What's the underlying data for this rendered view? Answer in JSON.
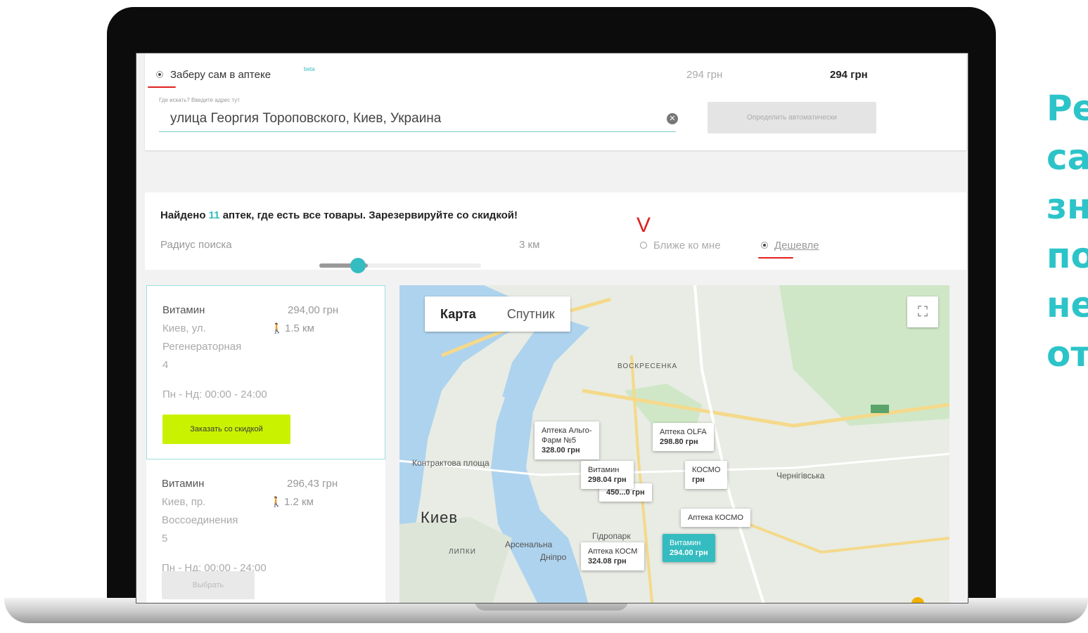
{
  "delivery": {
    "pickup_label": "Заберу сам в аптеке",
    "beta_badge": "beta",
    "price_left": "294 грн",
    "price_right": "294 грн"
  },
  "address": {
    "hint": "Где искать? Введите адрес тут",
    "value": "улица Георгия Тороповского, Киев, Украина",
    "auto_button": "Определить автоматически"
  },
  "filter": {
    "found_prefix": "Найдено",
    "found_count": "11",
    "found_suffix": "аптек, где есть все товары. Зарезервируйте со скидкой!",
    "radius_label": "Радиус поиска",
    "radius_value": "3 км",
    "radius_fraction": 0.3,
    "sort_nearer": "Ближе ко мне",
    "sort_cheaper": "Дешевле",
    "sort_selected": "Дешевле",
    "checkmark": "V"
  },
  "pharmacies": [
    {
      "name": "Витамин",
      "price": "294,00 грн",
      "distance": "1.5 км",
      "addr1": "Киев, ул.",
      "addr2": "Регенераторная",
      "addr3": "4",
      "hours": "Пн - Нд: 00:00 - 24:00",
      "button": "Заказать со скидкой"
    },
    {
      "name": "Витамин",
      "price": "296,43 грн",
      "distance": "1.2 км",
      "addr1": "Киев, пр.",
      "addr2": "Воссоединения",
      "addr3": "5",
      "hours": "Пн - Нд: 00:00 - 24:00",
      "button": "Выбрать"
    }
  ],
  "map": {
    "tab_map": "Карта",
    "tab_satellite": "Спутник",
    "city": "Киев",
    "labels": [
      "ВОСКРЕСЕНКА",
      "Контрактова площа",
      "Арсенальна",
      "Дніпро",
      "Чернігівська",
      "ЛИПКИ",
      "Гідропарк"
    ],
    "pins": [
      {
        "name": "Аптека Альго-",
        "name2": "Фарм №5",
        "price": "328.00 грн"
      },
      {
        "name": "Аптека OLFA",
        "price": "298.80 грн"
      },
      {
        "name": "Витамин",
        "price": "298.04 грн"
      },
      {
        "name": "КОСМО",
        "price": "грн"
      },
      {
        "name": "",
        "price": "450...0 грн"
      },
      {
        "name": "Аптека КОСМО",
        "price": ""
      },
      {
        "name": "Аптека КОСМ",
        "price": "324.08 грн"
      },
      {
        "name": "Витамин",
        "price": "294.00 грн"
      }
    ]
  },
  "promo_lines": [
    "Ре",
    "са",
    "зн",
    "по",
    "не",
    "от"
  ],
  "colors": {
    "accent": "#35bcc0",
    "order_button": "#c9f200",
    "promo_text": "#2cc4c8",
    "annotation_red": "#e02020"
  }
}
